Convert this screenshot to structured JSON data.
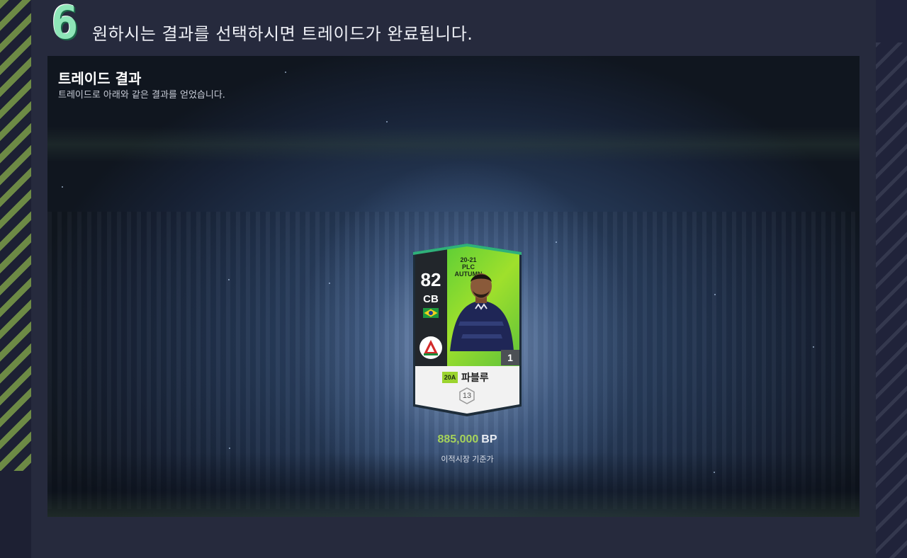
{
  "step": {
    "number": "6",
    "instruction": "원하시는 결과를 선택하시면 트레이드가 완료됩니다."
  },
  "trade_result": {
    "title": "트레이드 결과",
    "subtitle": "트레이드로 아래와 같은 결과를 얻었습니다."
  },
  "card": {
    "overall": "82",
    "position": "CB",
    "season_label": "20-21 PLC AUTUMN",
    "enhance_level": "1",
    "season_badge": "20A",
    "player_name": "파블루",
    "salary": "13",
    "flag_icon": "brazil-flag-icon",
    "club_icon": "club-logo-icon"
  },
  "price": {
    "value": "885,000",
    "unit": "BP",
    "caption": "이적시장 기준가"
  },
  "colors": {
    "accent_green": "#a6d35a",
    "stripe_green": "#6d8a45",
    "step_mint": "#8ee6b8",
    "background": "#262a3d"
  }
}
